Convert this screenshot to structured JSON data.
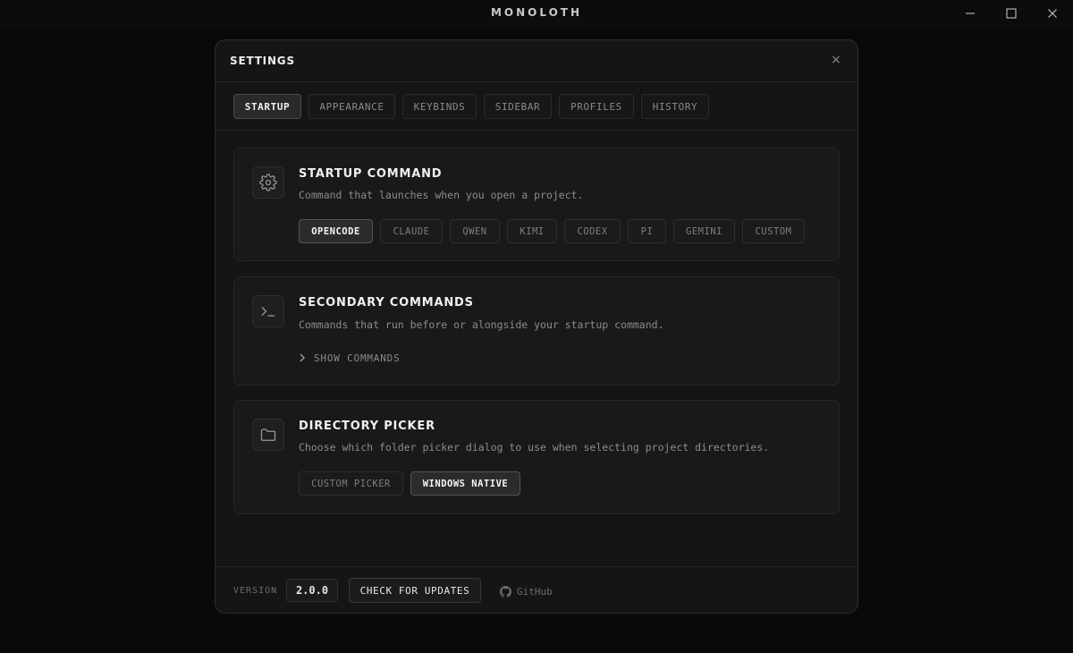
{
  "app": {
    "title": "MONOLOTH"
  },
  "modal": {
    "title": "SETTINGS",
    "close": "×"
  },
  "tabs": [
    {
      "label": "STARTUP",
      "active": true
    },
    {
      "label": "APPEARANCE",
      "active": false
    },
    {
      "label": "KEYBINDS",
      "active": false
    },
    {
      "label": "SIDEBAR",
      "active": false
    },
    {
      "label": "PROFILES",
      "active": false
    },
    {
      "label": "HISTORY",
      "active": false
    }
  ],
  "sections": {
    "startup": {
      "icon": "gear-icon",
      "title": "STARTUP COMMAND",
      "description": "Command that launches when you open a project.",
      "options": [
        "OPENCODE",
        "CLAUDE",
        "QWEN",
        "KIMI",
        "CODEX",
        "PI",
        "GEMINI",
        "CUSTOM"
      ],
      "selected": "OPENCODE"
    },
    "secondary": {
      "icon": "terminal-icon",
      "title": "SECONDARY COMMANDS",
      "description": "Commands that run before or alongside your startup command.",
      "toggle_label": "SHOW COMMANDS"
    },
    "directory": {
      "icon": "folder-icon",
      "title": "DIRECTORY PICKER",
      "description": "Choose which folder picker dialog to use when selecting project directories.",
      "options": [
        "CUSTOM PICKER",
        "WINDOWS NATIVE"
      ],
      "selected": "WINDOWS NATIVE"
    }
  },
  "footer": {
    "version_label": "VERSION",
    "version": "2.0.0",
    "update_label": "CHECK FOR UPDATES",
    "github_label": "GitHub"
  },
  "colors": {
    "background": "#050505",
    "modal": "#151515",
    "card": "#191919",
    "active": "#2a2a2a",
    "text": "#f0f0f0",
    "muted": "#8a8a8a"
  }
}
